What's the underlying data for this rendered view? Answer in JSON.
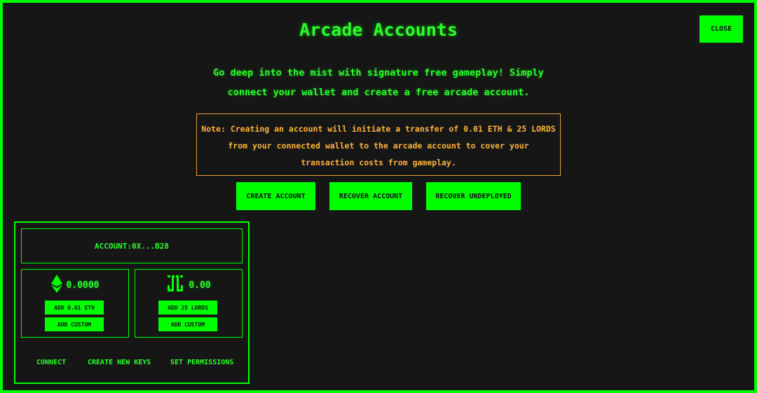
{
  "modal": {
    "title": "Arcade Accounts",
    "close_label": "CLOSE",
    "description_line1": "Go deep into the mist with signature free gameplay! Simply",
    "description_line2": "connect your wallet and create a free arcade account.",
    "note": "Note: Creating an account will initiate a transfer of 0.01 ETH & 25 LORDS from your connected wallet to the arcade account to cover your transaction costs from gameplay."
  },
  "actions": {
    "create_account": "CREATE ACCOUNT",
    "recover_account": "RECOVER ACCOUNT",
    "recover_undeployed": "RECOVER UNDEPLOYED"
  },
  "account": {
    "label": "ACCOUNT:0X...B28",
    "eth": {
      "icon": "ethereum-icon",
      "balance": "0.0000",
      "add_label": "ADD 0.01 ETH",
      "custom_label": "ADD CUSTOM"
    },
    "lords": {
      "icon": "lords-icon",
      "balance": "0.00",
      "add_label": "ADD 25 LORDS",
      "custom_label": "ADD CUSTOM"
    },
    "links": {
      "connect": "CONNECT",
      "create_keys": "CREATE NEW KEYS",
      "set_permissions": "SET PERMISSIONS"
    }
  },
  "colors": {
    "accent": "#00ff00",
    "warning": "#ffb43a",
    "background": "#161616"
  }
}
